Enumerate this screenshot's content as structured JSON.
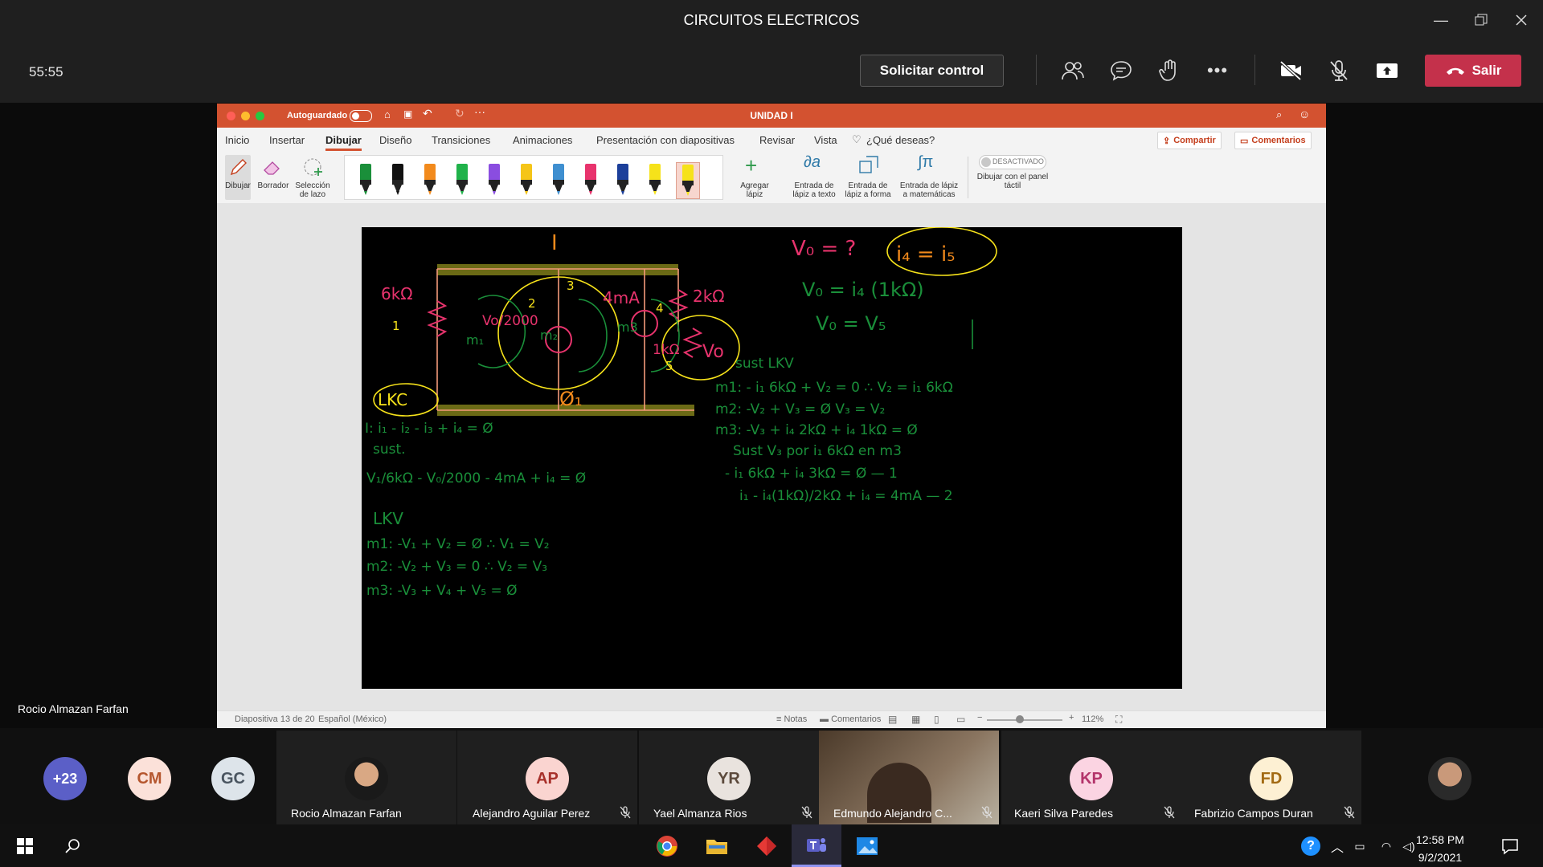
{
  "window": {
    "title": "CIRCUITOS ELECTRICOS"
  },
  "meeting": {
    "timer": "55:55",
    "request_control_label": "Solicitar control",
    "leave_label": "Salir",
    "presenter_name": "Rocio Almazan Farfan"
  },
  "ppt": {
    "autosave_label": "Autoguardado",
    "document_name": "UNIDAD I",
    "tabs": [
      "Inicio",
      "Insertar",
      "Dibujar",
      "Diseño",
      "Transiciones",
      "Animaciones",
      "Presentación con diapositivas",
      "Revisar",
      "Vista",
      "¿Qué deseas?"
    ],
    "share_label": "Compartir",
    "comments_label": "Comentarios",
    "tools": {
      "draw": "Dibujar",
      "eraser": "Borrador",
      "lasso": "Selección de lazo",
      "add_pen": "Agregar lápiz",
      "ink_to_text": "Entrada de lápiz a texto",
      "ink_to_shape": "Entrada de lápiz a forma",
      "ink_to_math": "Entrada de lápiz a matemáticas",
      "touch_toggle": "DESACTIVADO",
      "touch_label": "Dibujar con el panel táctil"
    },
    "pen_colors": [
      "#1a8f3a",
      "#111111",
      "#f28a1c",
      "#20b24a",
      "#8a4de0",
      "#f5c518",
      "#3f8fd0",
      "#e8336d",
      "#1c3f9a",
      "#f6e21a",
      "#f6e21a"
    ],
    "status": {
      "slide": "Diapositiva 13 de 20",
      "language": "Español (México)",
      "notes": "Notas",
      "comments": "Comentarios",
      "zoom": "112%"
    }
  },
  "slide_ink": {
    "top_label": "I",
    "r1": "6kΩ",
    "r2": "2kΩ",
    "vo_2000": "Vo/2000",
    "ma4": "4mA",
    "m1": "m₁",
    "m2": "m₂",
    "m3": "m3",
    "r_1k": "1kΩ",
    "vo": "Vo",
    "n1": "1",
    "n2": "2",
    "n3": "3",
    "n4": "4",
    "n5": "5",
    "lkc": "LKC",
    "ground": "Ø₁",
    "q1": "V₀ = ?",
    "q2": "i₄ = i₅",
    "eq_a": "V₀ = i₄ (1kΩ)",
    "eq_b": "V₀ = V₅",
    "sust_lkv": "sust  LKV",
    "m1e": "m1: - i₁ 6kΩ + V₂ = 0  ∴ V₂ = i₁ 6kΩ",
    "m2e": "m2: -V₂ + V₃ = Ø   V₃ = V₂",
    "m3e": "m3: -V₃ + i₄ 2kΩ + i₄ 1kΩ = Ø",
    "sust_m3": "Sust V₃ por i₁ 6kΩ en m3",
    "eq1": "- i₁ 6kΩ + i₄ 3kΩ = Ø   — 1",
    "eq2": "i₁ - i₄(1kΩ)/2kΩ + i₄ = 4mA  — 2",
    "lkc_eq": "I: i₁ - i₂ - i₃ + i₄ = Ø",
    "sust": "sust.",
    "big_eq": "V₁/6kΩ - V₀/2000 - 4mA + i₄ = Ø",
    "lkv": "LKV",
    "lm1": "m1: -V₁ + V₂ = Ø  ∴ V₁ = V₂",
    "lm2": "m2: -V₂ + V₃ = 0 ∴  V₂ = V₃",
    "lm3": "m3: -V₃ + V₄ + V₅ = Ø"
  },
  "participants": {
    "overflow_count": "+23",
    "overflow_avatars": [
      {
        "initials": "CM",
        "color": "#fbe1d9",
        "text_color": "#b5562e"
      },
      {
        "initials": "GC",
        "color": "#dde4ea",
        "text_color": "#4a5560"
      }
    ],
    "tiles": [
      {
        "name": "Rocio Almazan Farfan",
        "initials": "",
        "muted": false
      },
      {
        "name": "Alejandro Aguilar Perez",
        "initials": "AP",
        "color": "#fad4d0",
        "text_color": "#a8302a",
        "muted": true
      },
      {
        "name": "Yael Almanza Rios",
        "initials": "YR",
        "color": "#e9e3de",
        "text_color": "#5c4a3c",
        "muted": true
      },
      {
        "name": "Edmundo Alejandro C...",
        "initials": "",
        "muted": true
      },
      {
        "name": "Kaeri Silva Paredes",
        "initials": "KP",
        "color": "#fbd4e2",
        "text_color": "#b3336a",
        "muted": true
      },
      {
        "name": "Fabrizio Campos Duran",
        "initials": "FD",
        "color": "#fdf0d3",
        "text_color": "#a26a12",
        "muted": true
      }
    ]
  },
  "taskbar": {
    "time": "12:58 PM",
    "date": "9/2/2021"
  }
}
